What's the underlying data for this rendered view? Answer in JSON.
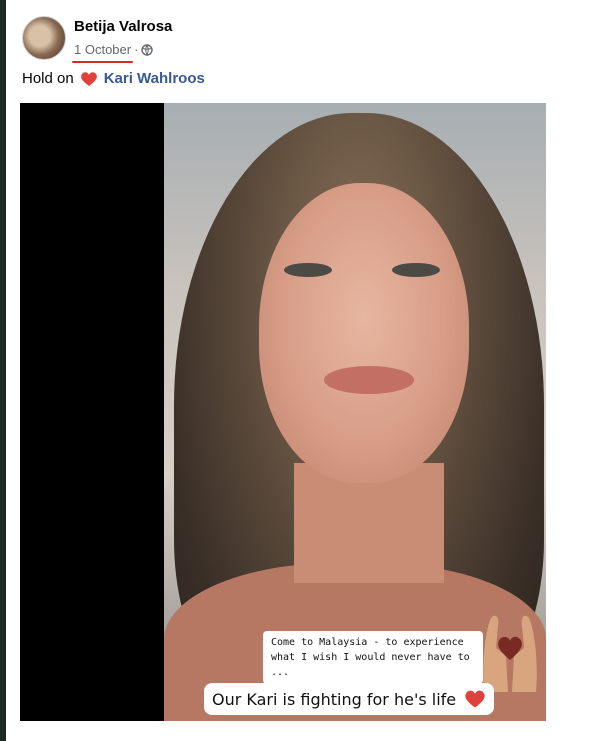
{
  "post": {
    "author": "Betija Valrosa",
    "date": "1 October",
    "separator": "·",
    "visibility_icon": "globe-icon",
    "text_before": "Hold on",
    "mention": "Kari Wahlroos",
    "text_icon": "heart-icon"
  },
  "image": {
    "caption_small": "Come to Malaysia - to experience what I wish I would never have to ...",
    "caption_big": "Our Kari is fighting for he's life",
    "overlay_icons": [
      "hands-heart-icon",
      "heart-icon"
    ]
  },
  "colors": {
    "link": "#385898",
    "heart": "#e0423b",
    "underline": "#d62b2b",
    "meta_text": "#65676b"
  }
}
